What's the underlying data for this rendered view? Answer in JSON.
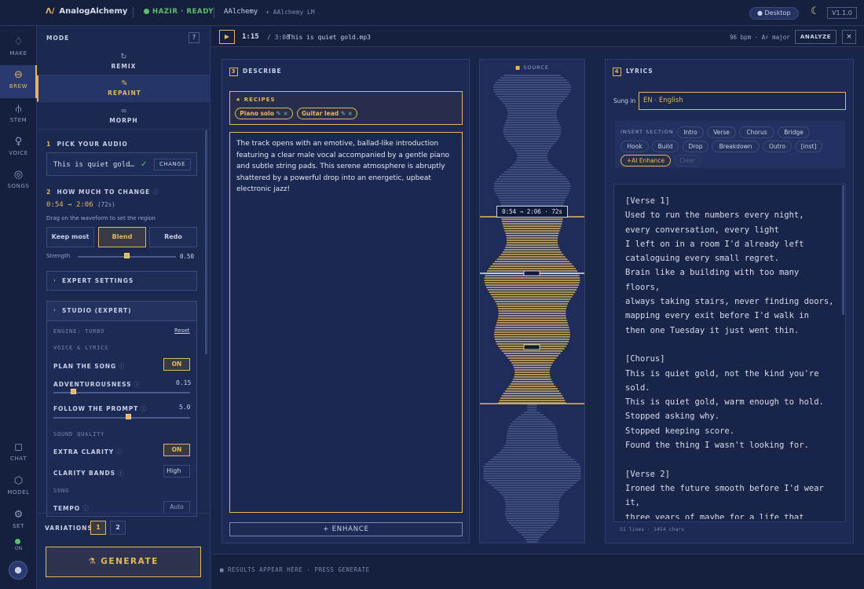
{
  "topbar": {
    "logo_glyph": "Λ∕",
    "logo_text": "AnalogAlchemy",
    "status": "HAZIR · READY",
    "app_name": "AAlchemy",
    "model_tag": "+ AAlchemy LM",
    "desktop": "● Desktop",
    "version": "V1.1.0"
  },
  "rail": {
    "items": [
      {
        "label": "MAKE",
        "icon": "flame-icon"
      },
      {
        "label": "BREW",
        "icon": "pot-icon"
      },
      {
        "label": "STEM",
        "icon": "fork-icon"
      },
      {
        "label": "VOICE",
        "icon": "mic-icon"
      },
      {
        "label": "SONGS",
        "icon": "disc-icon"
      },
      {
        "label": "CHAT",
        "icon": "chat-icon"
      },
      {
        "label": "MODEL",
        "icon": "cube-icon"
      },
      {
        "label": "SET",
        "icon": "gear-icon"
      }
    ],
    "on_label": "ON"
  },
  "left": {
    "mode_label": "MODE",
    "help": "?",
    "modes": [
      "REMIX",
      "REPAINT",
      "MORPH"
    ],
    "step1_num": "1",
    "step1_label": "PICK YOUR AUDIO",
    "audio_file": "This is quiet gold…",
    "change_btn": "CHANGE",
    "step2_num": "2",
    "step2_label": "HOW MUCH TO CHANGE",
    "range_start": "0:54",
    "range_arrow": "→",
    "range_end": "2:06",
    "range_len": "(72s)",
    "drag_hint": "Drag on the waveform to set the region",
    "amount_opts": [
      "Keep most",
      "Blend",
      "Redo"
    ],
    "strength_label": "Strength",
    "strength_value": "0.50",
    "strength": 0.5,
    "expert_settings": "EXPERT SETTINGS",
    "studio_title": "STUDIO (EXPERT)",
    "engine": "ENGINE: TURBO",
    "reset": "Reset",
    "voice_lyrics": "VOICE & LYRICS",
    "plan_song": "PLAN THE SONG",
    "plan_song_state": "ON",
    "adventurousness": "ADVENTUROUSNESS",
    "adventurousness_value": "0.15",
    "adventurousness_level": 0.15,
    "follow_prompt": "FOLLOW THE PROMPT",
    "follow_prompt_value": "5.0",
    "follow_prompt_level": 0.55,
    "sound_quality": "SOUND QUALITY",
    "extra_clarity": "EXTRA CLARITY",
    "extra_clarity_state": "ON",
    "clarity_bands": "CLARITY BANDS",
    "clarity_bands_value": "High",
    "song": "SONG",
    "tempo": "TEMPO",
    "tempo_value": "Auto",
    "variations_label": "VARIATIONS",
    "variations": [
      "1",
      "2"
    ],
    "generate": "GENERATE"
  },
  "playbar": {
    "time": "1:15",
    "total": "/ 3:08",
    "file": "This is quiet gold.mp3",
    "bpm": "96 bpm · A♯ major",
    "analyze": "ANALYZE",
    "close": "×"
  },
  "describe": {
    "num": "3",
    "title": "DESCRIBE",
    "recipes_label": "RECIPES",
    "recipes": [
      "Piano solo",
      "Guitar lead"
    ],
    "text": "The track opens with an emotive, ballad-like introduction featuring a clear male vocal accompanied by a gentle piano and subtle string pads. This serene atmosphere is abruptly shattered by a powerful drop into an energetic, upbeat electronic jazz!",
    "enhance": "+ ENHANCE"
  },
  "source": {
    "label": "SOURCE",
    "region": "0:54 → 2:06 · 72s",
    "colors": {
      "selected": "#d9b25a",
      "unselected": "#4a5a8a"
    }
  },
  "lyrics": {
    "num": "4",
    "title": "LYRICS",
    "sung_in_label": "Sung in",
    "sung_in": "EN · English",
    "insert_label": "INSERT SECTION",
    "sections_row1": [
      "Intro",
      "Verse",
      "Chorus",
      "Bridge"
    ],
    "sections_row2": [
      "Hook",
      "Build",
      "Drop",
      "Breakdown",
      "Outro",
      "[inst]"
    ],
    "ai_enhance": "+AI Enhance",
    "clear": "Clear",
    "text": "[Verse 1]\nUsed to run the numbers every night,\nevery conversation, every light\nI left on in a room I'd already left\ncataloguing every small regret.\nBrain like a building with too many floors,\nalways taking stairs, never finding doors,\nmapping every exit before I'd walk in\nthen one Tuesday it just went thin.\n\n[Chorus]\nThis is quiet gold, not the kind you're sold.\nThis is quiet gold, warm enough to hold.\nStopped asking why.\nStopped keeping score.\nFound the thing I wasn't looking for.\n\n[Verse 2]\nIroned the future smooth before I'd wear it,\nthree years of maybe for a life that",
    "stats": "51 lines · 1454 chars"
  },
  "bottom": {
    "results": "RESULTS APPEAR HERE · PRESS GENERATE"
  }
}
